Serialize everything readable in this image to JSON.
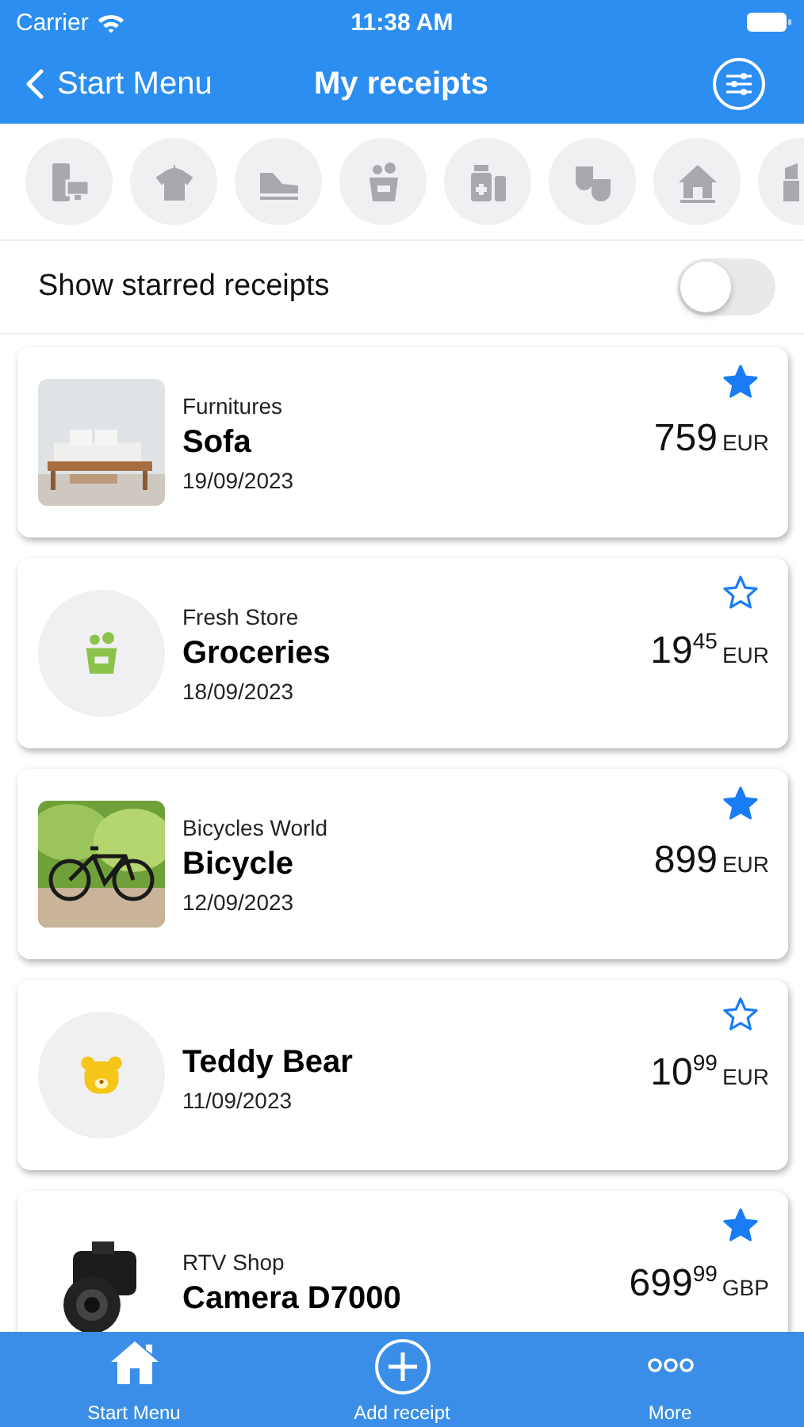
{
  "status_bar": {
    "carrier": "Carrier",
    "time": "11:38 AM"
  },
  "nav": {
    "back": "Start Menu",
    "title": "My receipts"
  },
  "categories": [
    {
      "kind": "appliances"
    },
    {
      "kind": "clothes"
    },
    {
      "kind": "shoes"
    },
    {
      "kind": "groceries"
    },
    {
      "kind": "pharmacy"
    },
    {
      "kind": "theatre"
    },
    {
      "kind": "home"
    },
    {
      "kind": "cosmetics"
    }
  ],
  "filter": {
    "label": "Show starred receipts",
    "on": false
  },
  "receipts": [
    {
      "kind": "picture",
      "store": "Furnitures",
      "name": "Sofa",
      "date": "19/09/2023",
      "amount": "759",
      "currency": "EUR",
      "starred": true
    },
    {
      "kind": "icon",
      "store": "Fresh Store",
      "name": "Groceries",
      "date": "18/09/2023",
      "amount": "19$^{45}$",
      "currency": "EUR",
      "starred": false
    },
    {
      "kind": "picture",
      "store": "Bicycles World",
      "name": "Bicycle",
      "date": "12/09/2023",
      "amount": "899",
      "currency": "EUR",
      "starred": true
    },
    {
      "kind": "icon",
      "name": "Teddy Bear",
      "date": "11/09/2023",
      "amount": "10$^{99}$",
      "currency": "EUR",
      "starred": false
    },
    {
      "kind": "picture",
      "store": "RTV Shop",
      "name": "Camera D7000",
      "amount": "699$^{99}$",
      "currency": "GBP",
      "starred": true
    }
  ],
  "tab_bar": [
    {
      "label": "Start Menu"
    },
    {
      "label": "Add receipt"
    },
    {
      "label": "More"
    }
  ]
}
